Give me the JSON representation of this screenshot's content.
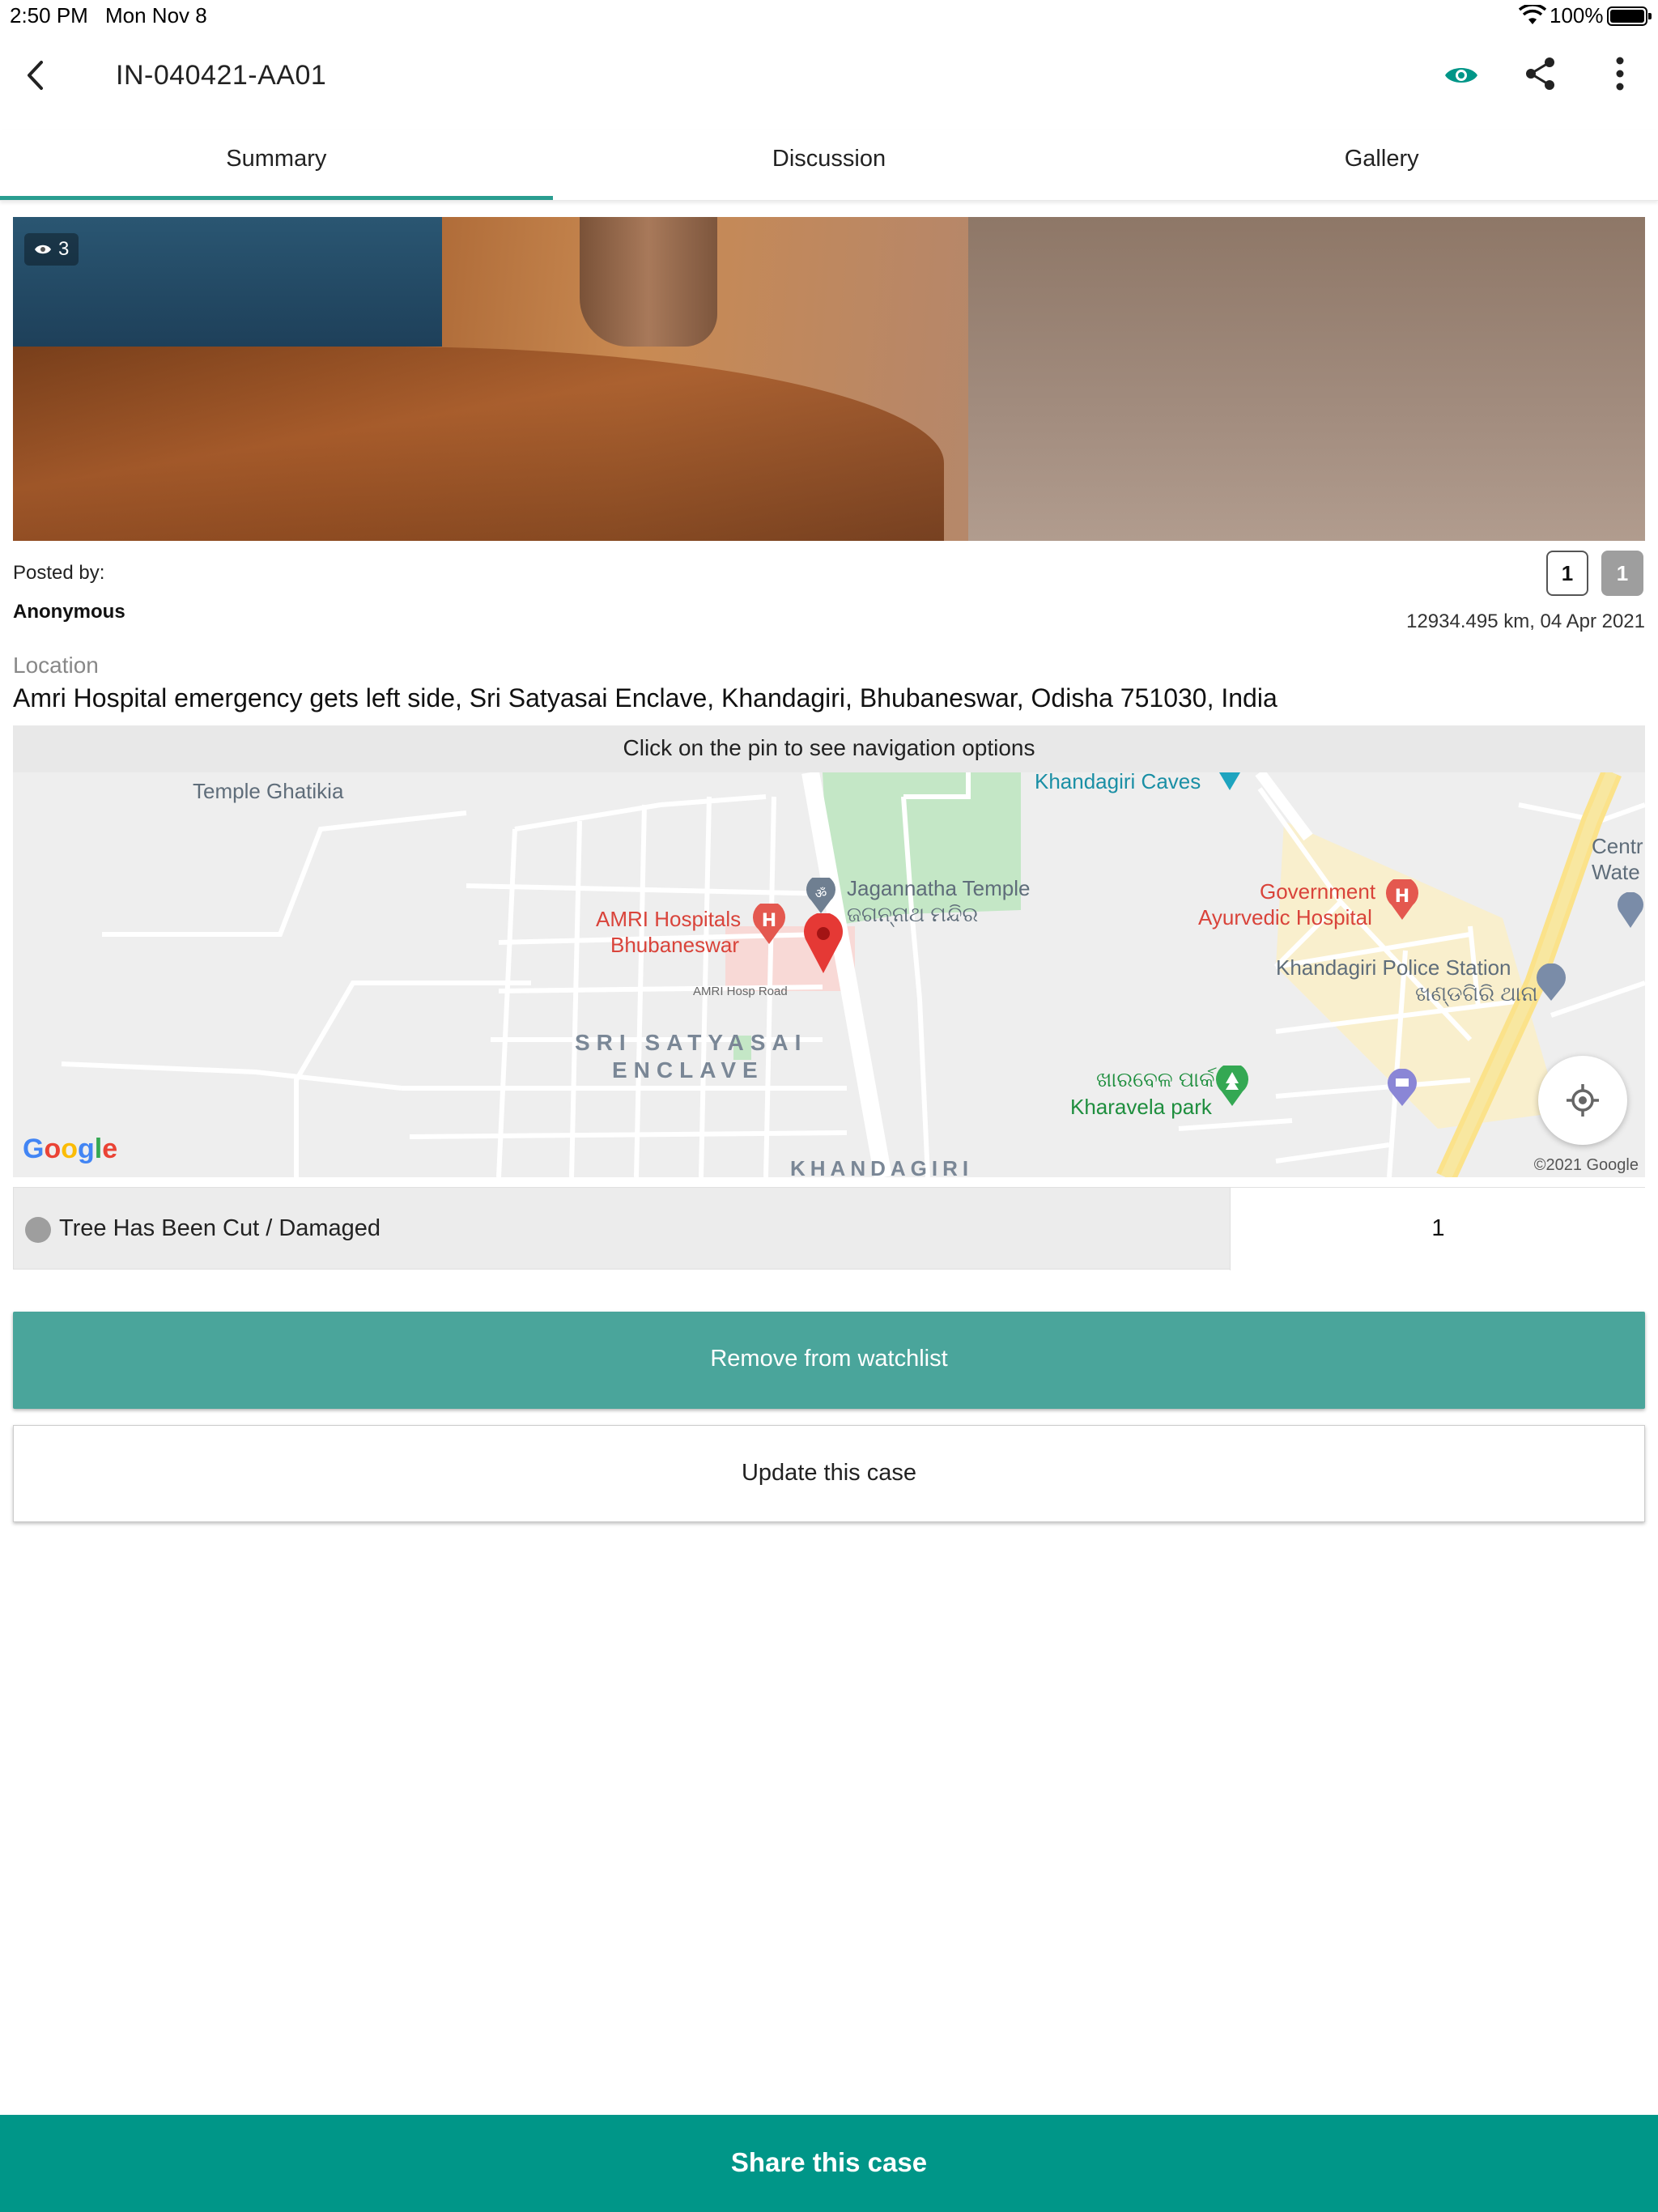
{
  "status_bar": {
    "time": "2:50 PM",
    "date": "Mon Nov 8",
    "battery": "100%"
  },
  "header": {
    "case_id": "IN-040421-AA01"
  },
  "tabs": [
    {
      "label": "Summary",
      "active": true
    },
    {
      "label": "Discussion",
      "active": false
    },
    {
      "label": "Gallery",
      "active": false
    }
  ],
  "photo": {
    "views": "3"
  },
  "meta": {
    "posted_by_label": "Posted by:",
    "posted_by": "Anonymous",
    "counter_a": "1",
    "counter_b": "1",
    "distance_date": "12934.495 km, 04 Apr 2021"
  },
  "location": {
    "label": "Location",
    "address": "Amri Hospital emergency gets left side, Sri Satyasai Enclave, Khandagiri, Bhubaneswar, Odisha 751030, India",
    "map_hint": "Click on the pin to see navigation options"
  },
  "map": {
    "labels": {
      "temple_ghatikia": "Temple Ghatikia",
      "khandagiri_caves": "Khandagiri Caves",
      "centr_water": "Centr",
      "centr_water2": "Wate",
      "jagannatha": "Jagannatha Temple",
      "jagannatha_odia": "ଜଗନ୍ନାଥ ମନ୍ଦିର",
      "amri_1": "AMRI Hospitals",
      "amri_2": "Bhubaneswar",
      "gov_1": "Government",
      "gov_2": "Ayurvedic Hospital",
      "police": "Khandagiri Police Station",
      "police_odia": "ଖଣ୍ଡଗିରି ଥାନା",
      "amri_road": "AMRI Hosp Road",
      "satyasai_1": "SRI SATYASAI",
      "satyasai_2": "ENCLAVE",
      "kharavela_odia": "ଖାରବେଳ ପାର୍କ",
      "kharavela": "Kharavela park",
      "khandagiri": "KHANDAGIRI"
    },
    "copyright": "©2021 Google",
    "logo": "Google"
  },
  "category": {
    "label": "Tree Has Been Cut / Damaged",
    "count": "1"
  },
  "buttons": {
    "watchlist": "Remove from watchlist",
    "update": "Update this case",
    "share": "Share this case"
  },
  "colors": {
    "accent": "#009688",
    "watch_button": "#4aa59b",
    "tab_indicator": "#2a9d90",
    "pin": "#e53935"
  }
}
